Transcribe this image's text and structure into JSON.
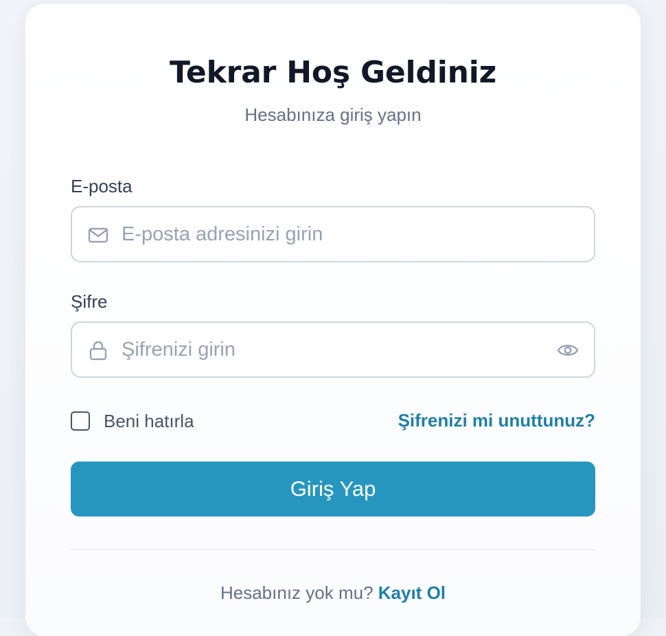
{
  "header": {
    "title": "Tekrar Hoş Geldiniz",
    "subtitle": "Hesabınıza giriş yapın"
  },
  "form": {
    "email": {
      "label": "E-posta",
      "placeholder": "E-posta adresinizi girin",
      "value": "",
      "icon": "mail-icon"
    },
    "password": {
      "label": "Şifre",
      "placeholder": "Şifrenizi girin",
      "value": "",
      "icon": "lock-icon",
      "toggle_icon": "eye-icon"
    },
    "remember_label": "Beni hatırla",
    "remember_checked": false,
    "forgot_label": "Şifrenizi mi unuttunuz?",
    "submit_label": "Giriş Yap"
  },
  "footer": {
    "prompt": "Hesabınız yok mu?",
    "signup_label": "Kayıt Ol"
  },
  "colors": {
    "primary": "#2796bf",
    "link": "#1f7fa6",
    "title": "#111827",
    "muted": "#667085",
    "border": "#d0d5dd"
  }
}
